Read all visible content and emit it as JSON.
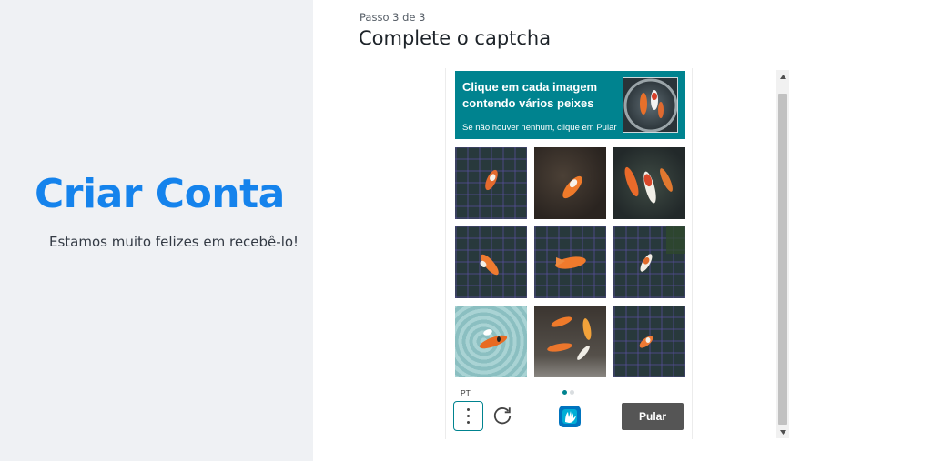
{
  "left": {
    "title": "Criar Conta",
    "subtitle": "Estamos muito felizes em recebê-lo!"
  },
  "header": {
    "step": "Passo 3 de 3",
    "title": "Complete o captcha"
  },
  "captcha": {
    "prompt": "Clique em cada imagem contendo vários peixes",
    "hint": "Se não houver nenhum, clique em Pular",
    "language": "PT",
    "skip_label": "Pular",
    "page": 1,
    "pages": 2
  },
  "colors": {
    "brand": "#1583ec",
    "captcha_accent": "#00838f",
    "skip_button": "#555555"
  },
  "icons": {
    "menu": "vertical-ellipsis-icon",
    "refresh": "refresh-icon",
    "logo": "hcaptcha-logo-icon"
  }
}
